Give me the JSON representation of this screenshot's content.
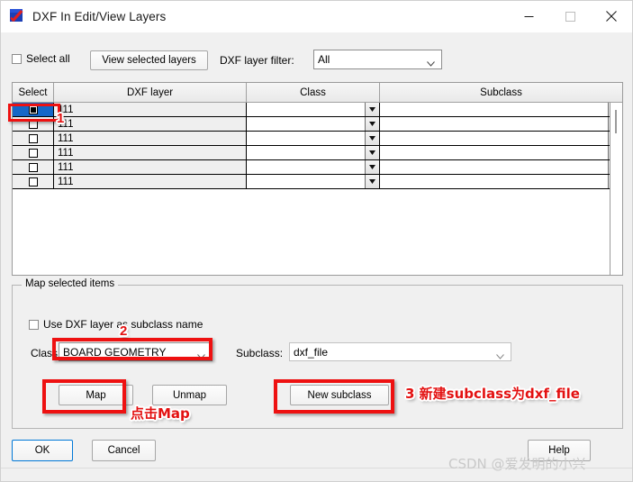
{
  "window": {
    "title": "DXF In Edit/View Layers",
    "icon": "dxf-app-icon",
    "controls": {
      "minimize": "minimize-icon",
      "maximize": "maximize-icon",
      "close": "close-icon"
    }
  },
  "toolbar": {
    "select_all_label": "Select all",
    "select_all_checked": false,
    "view_selected_layers_label": "View selected layers",
    "filter_label": "DXF layer filter:",
    "filter_value": "All"
  },
  "table": {
    "columns": [
      "Select",
      "DXF layer",
      "Class",
      "Subclass"
    ],
    "rows": [
      {
        "selected": true,
        "layer": "111",
        "class": "",
        "subclass": ""
      },
      {
        "selected": false,
        "layer": "111",
        "class": "",
        "subclass": ""
      },
      {
        "selected": false,
        "layer": "111",
        "class": "",
        "subclass": ""
      },
      {
        "selected": false,
        "layer": "111",
        "class": "",
        "subclass": ""
      },
      {
        "selected": false,
        "layer": "111",
        "class": "",
        "subclass": ""
      },
      {
        "selected": false,
        "layer": "111",
        "class": "",
        "subclass": ""
      }
    ]
  },
  "map_group": {
    "title": "Map selected items",
    "use_dxf_layer_label": "Use DXF layer as subclass name",
    "use_dxf_layer_checked": false,
    "class_label": "Class:",
    "class_value": "BOARD GEOMETRY",
    "subclass_label": "Subclass:",
    "subclass_value": "dxf_file",
    "map_label": "Map",
    "unmap_label": "Unmap",
    "new_subclass_label": "New subclass"
  },
  "footer": {
    "ok_label": "OK",
    "cancel_label": "Cancel",
    "help_label": "Help",
    "watermark": "CSDN @爱发明的小兴"
  },
  "annotations": {
    "num1": "1",
    "num2": "2",
    "click_map": "点击Map",
    "new_subclass_note": "3 新建subclass为dxf_file",
    "color": "#ee1111"
  }
}
